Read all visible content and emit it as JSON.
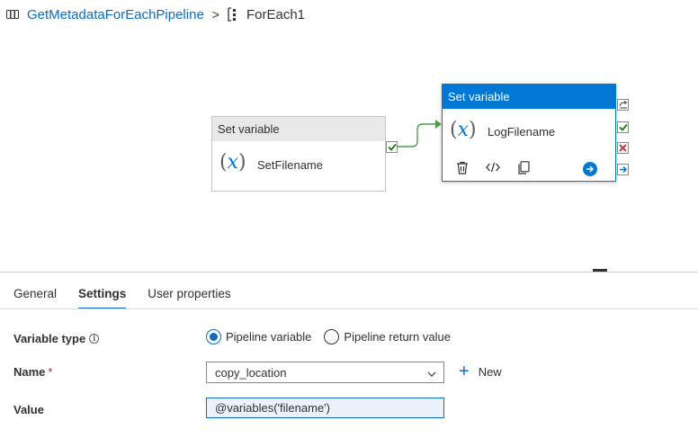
{
  "breadcrumb": {
    "pipeline": "GetMetadataForEachPipeline",
    "separator": ">",
    "current": "ForEach1"
  },
  "canvas": {
    "activity1": {
      "type_label": "Set variable",
      "icon_text": "x",
      "name": "SetFilename"
    },
    "activity2": {
      "type_label": "Set variable",
      "icon_text": "x",
      "name": "LogFilename"
    }
  },
  "tabs": [
    {
      "label": "General",
      "active": false
    },
    {
      "label": "Settings",
      "active": true
    },
    {
      "label": "User properties",
      "active": false
    }
  ],
  "settings": {
    "variable_type": {
      "label": "Variable type",
      "info": "i",
      "options": [
        {
          "label": "Pipeline variable",
          "selected": true
        },
        {
          "label": "Pipeline return value",
          "selected": false
        }
      ]
    },
    "name": {
      "label": "Name",
      "required_mark": "*",
      "value": "copy_location",
      "new_label": "New",
      "new_icon": "+"
    },
    "value": {
      "label": "Value",
      "value": "@variables('filename')"
    }
  },
  "colors": {
    "accent": "#0078d4",
    "link": "#0f6cbd",
    "success": "#107c10",
    "error": "#d13438"
  }
}
